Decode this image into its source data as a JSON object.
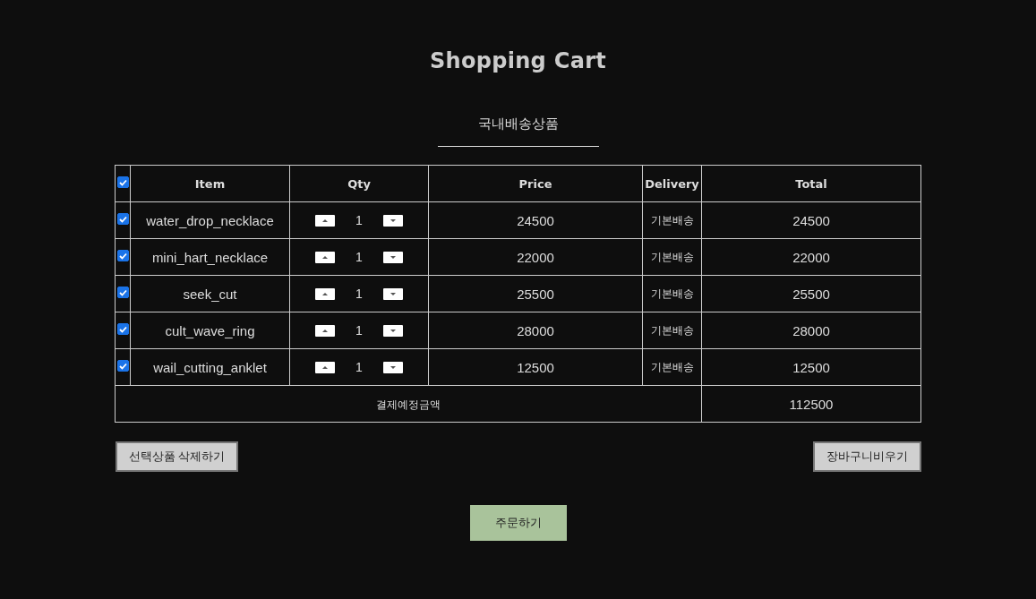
{
  "title": "Shopping Cart",
  "section_tab": "국내배송상품",
  "table": {
    "select_all": {
      "checked": true
    },
    "columns": [
      "Item",
      "Qty",
      "Price",
      "Delivery",
      "Total"
    ],
    "rows": [
      {
        "checked": true,
        "item": "water_drop_necklace",
        "qty": "1",
        "price": "24500",
        "delivery": "기본배송",
        "total": "24500"
      },
      {
        "checked": true,
        "item": "mini_hart_necklace",
        "qty": "1",
        "price": "22000",
        "delivery": "기본배송",
        "total": "22000"
      },
      {
        "checked": true,
        "item": "seek_cut",
        "qty": "1",
        "price": "25500",
        "delivery": "기본배송",
        "total": "25500"
      },
      {
        "checked": true,
        "item": "cult_wave_ring",
        "qty": "1",
        "price": "28000",
        "delivery": "기본배송",
        "total": "28000"
      },
      {
        "checked": true,
        "item": "wail_cutting_anklet",
        "qty": "1",
        "price": "12500",
        "delivery": "기본배송",
        "total": "12500"
      }
    ],
    "summary": {
      "label": "결제예정금액",
      "value": "112500"
    }
  },
  "buttons": {
    "delete_selected": "선택상품 삭제하기",
    "clear_cart": "장바구니비우기",
    "order": "주문하기"
  }
}
